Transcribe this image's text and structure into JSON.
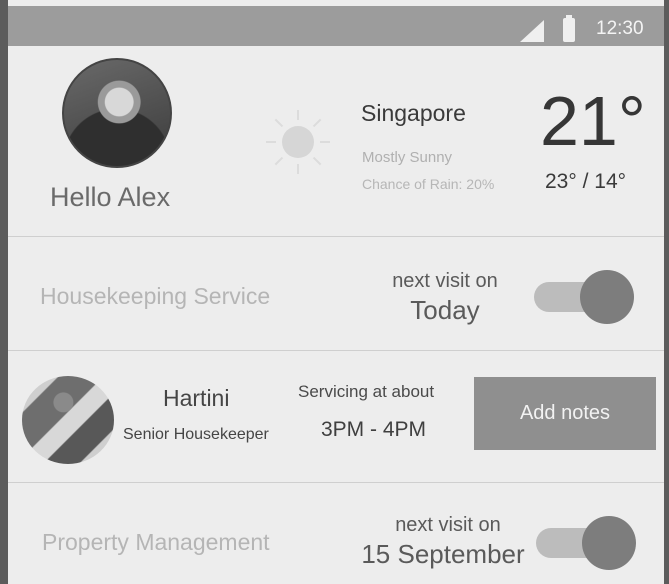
{
  "status_bar": {
    "time": "12:30"
  },
  "user": {
    "greeting": "Hello Alex"
  },
  "weather": {
    "city": "Singapore",
    "condition": "Mostly Sunny",
    "rain": "Chance of Rain: 20%",
    "temperature": "21°",
    "high_low": "23° / 14°",
    "icon": "sun-icon"
  },
  "services": [
    {
      "label": "Housekeeping Service",
      "next_label": "next visit on",
      "next_date": "Today",
      "enabled": true
    },
    {
      "label": "Property Management",
      "next_label": "next visit on",
      "next_date": "15 September",
      "enabled": true
    }
  ],
  "housekeeper": {
    "name": "Hartini",
    "role": "Senior Housekeeper",
    "servicing_label": "Servicing at about",
    "servicing_time": "3PM - 4PM",
    "add_notes_label": "Add notes"
  },
  "colors": {
    "accent": "#8f8f8f",
    "background": "#ededed",
    "status_bar": "#9c9c9c"
  }
}
